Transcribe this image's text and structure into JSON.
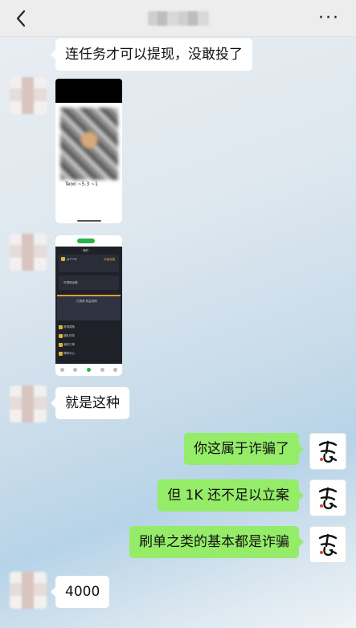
{
  "header": {
    "back_icon": "chevron-left-icon",
    "more_label": "···"
  },
  "messages": {
    "m1": "连任务才可以提现，没敢投了",
    "m2": "就是这种",
    "m3": "你这属于诈骗了",
    "m4": "但 1K 还不足以立案",
    "m5": "刷单之类的基本都是诈骗",
    "m6": "4000"
  },
  "qr_image": {
    "caption": "Teoo ~5.3 ~1"
  },
  "app_image": {
    "top_title": "我的",
    "user_name": "jq****8",
    "badge": "升级设置",
    "balance_label": "可提现余额",
    "banner_text": "已邀请 收益说明",
    "rows": [
      "邀请奖励",
      "团队任务",
      "我的订单",
      "帮助中心"
    ]
  },
  "colors": {
    "self_bubble": "#95ec69",
    "other_bubble": "#ffffff",
    "header_bg": "#ededed"
  }
}
